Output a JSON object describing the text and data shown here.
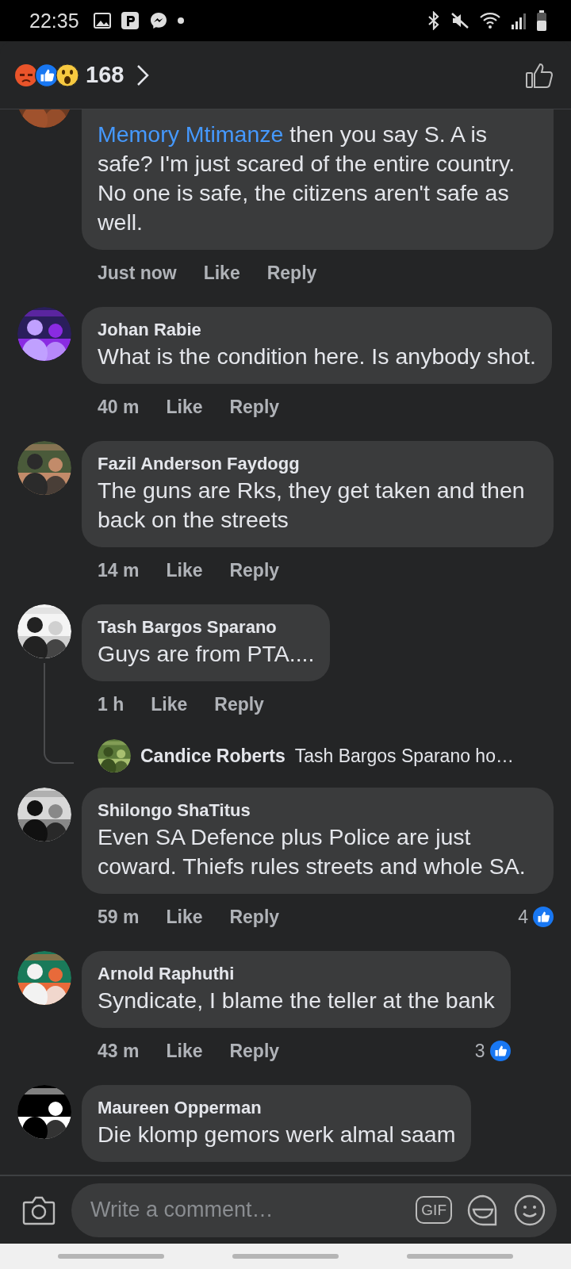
{
  "status_bar": {
    "time": "22:35"
  },
  "header": {
    "reaction_count": "168"
  },
  "comments": [
    {
      "mention": "Memory Mtimanze",
      "text": "then you say S. A is safe? I'm just scared of the entire country. No one is safe, the citizens aren't safe as well.",
      "time": "Just now",
      "like": "Like",
      "reply": "Reply"
    },
    {
      "author": "Johan Rabie",
      "text": "What is the condition here. Is anybody shot.",
      "time": "40 m",
      "like": "Like",
      "reply": "Reply"
    },
    {
      "author": "Fazil Anderson Faydogg",
      "text": "The guns are Rks, they get taken and then back on the streets",
      "time": "14 m",
      "like": "Like",
      "reply": "Reply"
    },
    {
      "author": "Tash Bargos Sparano",
      "text": "Guys are from PTA....",
      "time": "1 h",
      "like": "Like",
      "reply": "Reply",
      "reply_preview": {
        "author": "Candice Roberts",
        "text": "Tash Bargos Sparano ho…"
      }
    },
    {
      "author": "Shilongo ShaTitus",
      "text": "Even SA Defence plus Police are just coward. Thiefs rules streets and whole SA.",
      "time": "59 m",
      "like": "Like",
      "reply": "Reply",
      "likes": "4"
    },
    {
      "author": "Arnold Raphuthi",
      "text": "Syndicate, I blame the teller at the bank",
      "time": "43 m",
      "like": "Like",
      "reply": "Reply",
      "likes": "3"
    },
    {
      "author": "Maureen Opperman",
      "text": "Die klomp gemors werk almal saam"
    }
  ],
  "composer": {
    "placeholder": "Write a comment…",
    "gif": "GIF"
  }
}
